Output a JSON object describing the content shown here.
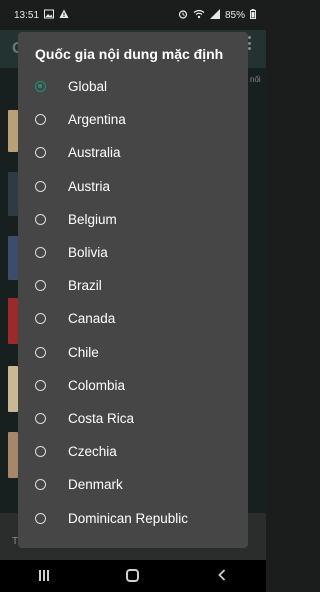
{
  "status_bar": {
    "time": "13:51",
    "left_icons": [
      "image-icon",
      "warning-icon"
    ],
    "right_icons": [
      "alarm-icon",
      "wifi-icon",
      "signal-icon"
    ],
    "battery": "85%"
  },
  "background": {
    "header_letter": "G",
    "side_text": "nối",
    "bottom_letter": "T"
  },
  "dialog": {
    "title": "Quốc gia nội dung mặc định",
    "selected": "Global",
    "options": [
      {
        "label": "Global",
        "selected": true
      },
      {
        "label": "Argentina",
        "selected": false
      },
      {
        "label": "Australia",
        "selected": false
      },
      {
        "label": "Austria",
        "selected": false
      },
      {
        "label": "Belgium",
        "selected": false
      },
      {
        "label": "Bolivia",
        "selected": false
      },
      {
        "label": "Brazil",
        "selected": false
      },
      {
        "label": "Canada",
        "selected": false
      },
      {
        "label": "Chile",
        "selected": false
      },
      {
        "label": "Colombia",
        "selected": false
      },
      {
        "label": "Costa Rica",
        "selected": false
      },
      {
        "label": "Czechia",
        "selected": false
      },
      {
        "label": "Denmark",
        "selected": false
      },
      {
        "label": "Dominican Republic",
        "selected": false
      }
    ]
  },
  "colors": {
    "dialog_bg": "#464646",
    "accent": "#1f8f7b",
    "app_bg": "#18201f"
  },
  "nav_bar": {
    "buttons": [
      "recents-icon",
      "home-icon",
      "back-icon"
    ]
  }
}
